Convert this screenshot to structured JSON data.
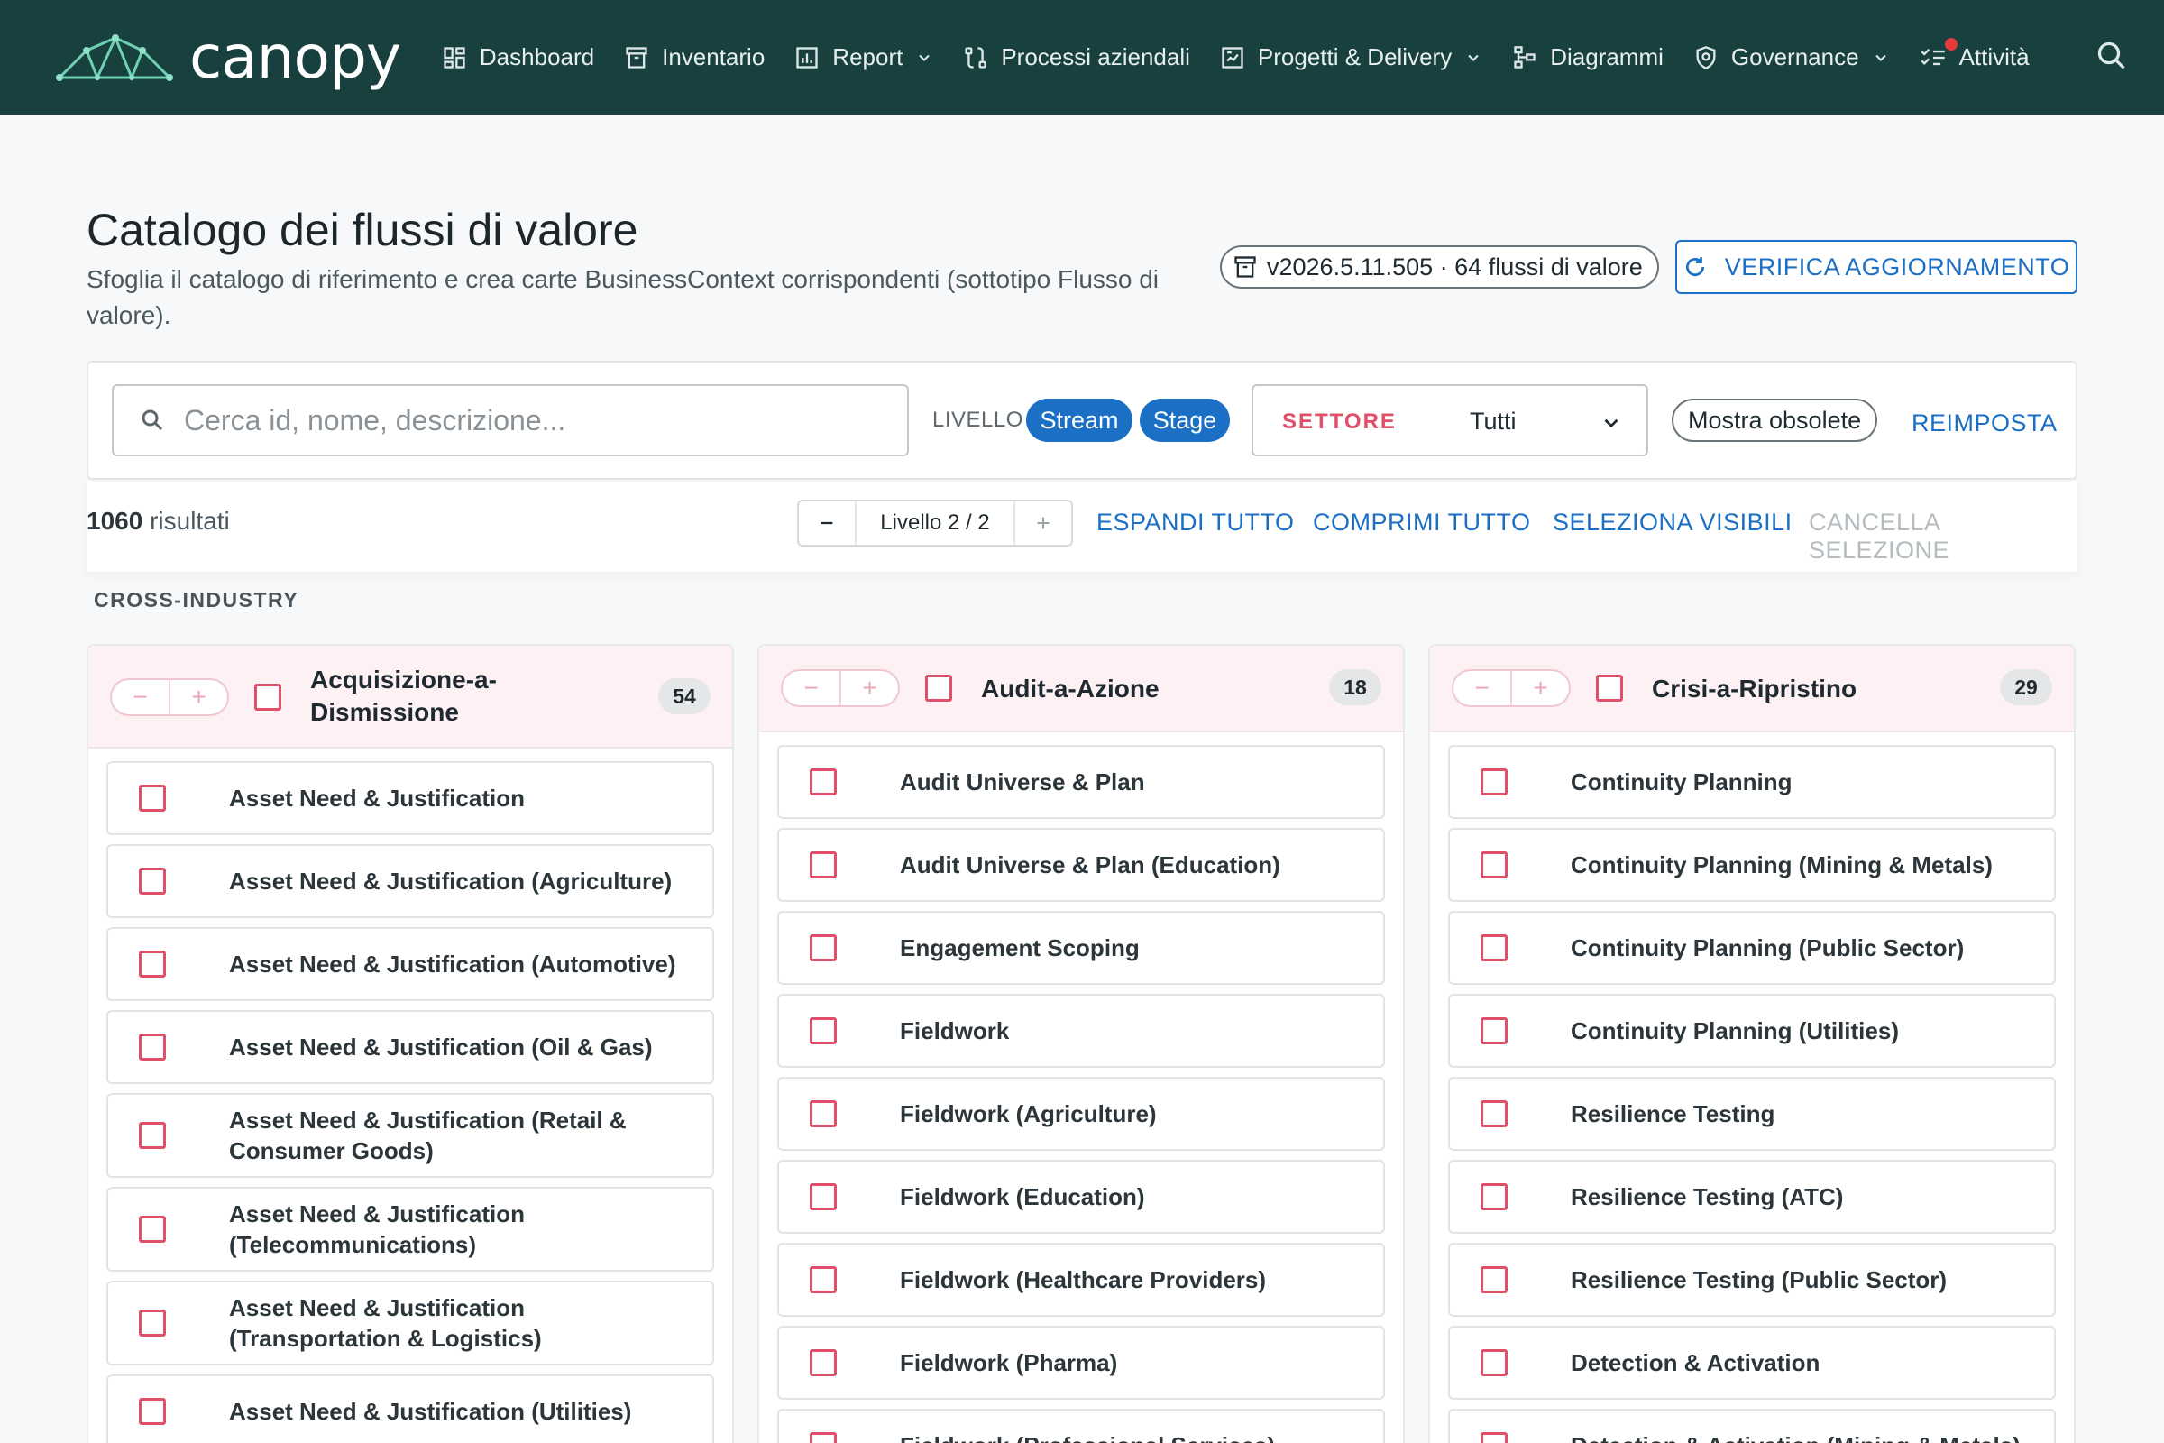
{
  "app": {
    "logo_text": "canopy",
    "nav": [
      {
        "label": "Dashboard",
        "icon": "dashboard-icon",
        "dropdown": false
      },
      {
        "label": "Inventario",
        "icon": "archive-icon",
        "dropdown": false
      },
      {
        "label": "Report",
        "icon": "bar-chart-icon",
        "dropdown": true
      },
      {
        "label": "Processi aziendali",
        "icon": "process-icon",
        "dropdown": false
      },
      {
        "label": "Progetti & Delivery",
        "icon": "project-icon",
        "dropdown": true
      },
      {
        "label": "Diagrammi",
        "icon": "diagram-icon",
        "dropdown": false
      },
      {
        "label": "Governance",
        "icon": "shield-icon",
        "dropdown": true
      },
      {
        "label": "Attività",
        "icon": "checklist-icon",
        "dropdown": false
      }
    ]
  },
  "header": {
    "title": "Catalogo dei flussi di valore",
    "description": "Sfoglia il catalogo di riferimento e crea carte BusinessContext corrispondenti (sottotipo Flusso di valore).",
    "version": "v2026.5.11.505 · 64 flussi di valore",
    "check_update": "VERIFICA AGGIORNAMENTO"
  },
  "filters": {
    "search_placeholder": "Cerca id, nome, descrizione...",
    "level_label": "LIVELLO",
    "level_stream": "Stream",
    "level_stage": "Stage",
    "sector_label": "SETTORE",
    "sector_value": "Tutti",
    "show_obsolete": "Mostra obsolete",
    "reset": "REIMPOSTA"
  },
  "results": {
    "count": "1060",
    "count_suffix": " risultati",
    "level_stepper": "Livello 2 / 2",
    "expand_all": "ESPANDI TUTTO",
    "collapse_all": "COMPRIMI TUTTO",
    "select_visible": "SELEZIONA VISIBILI",
    "clear_selection": "CANCELLA SELEZIONE"
  },
  "section": "CROSS-INDUSTRY",
  "columns": [
    {
      "title": "Acquisizione-a-Dismissione",
      "count": "54",
      "items": [
        "Asset Need & Justification",
        "Asset Need & Justification (Agriculture)",
        "Asset Need & Justification (Automotive)",
        "Asset Need & Justification (Oil & Gas)",
        "Asset Need & Justification (Retail & Consumer Goods)",
        "Asset Need & Justification (Telecommunications)",
        "Asset Need & Justification (Transportation & Logistics)",
        "Asset Need & Justification (Utilities)"
      ]
    },
    {
      "title": "Audit-a-Azione",
      "count": "18",
      "items": [
        "Audit Universe & Plan",
        "Audit Universe & Plan (Education)",
        "Engagement Scoping",
        "Fieldwork",
        "Fieldwork (Agriculture)",
        "Fieldwork (Education)",
        "Fieldwork (Healthcare Providers)",
        "Fieldwork (Pharma)",
        "Fieldwork (Professional Services)"
      ]
    },
    {
      "title": "Crisi-a-Ripristino",
      "count": "29",
      "items": [
        "Continuity Planning",
        "Continuity Planning (Mining & Metals)",
        "Continuity Planning (Public Sector)",
        "Continuity Planning (Utilities)",
        "Resilience Testing",
        "Resilience Testing (ATC)",
        "Resilience Testing (Public Sector)",
        "Detection & Activation",
        "Detection & Activation (Mining & Metals)"
      ]
    }
  ]
}
